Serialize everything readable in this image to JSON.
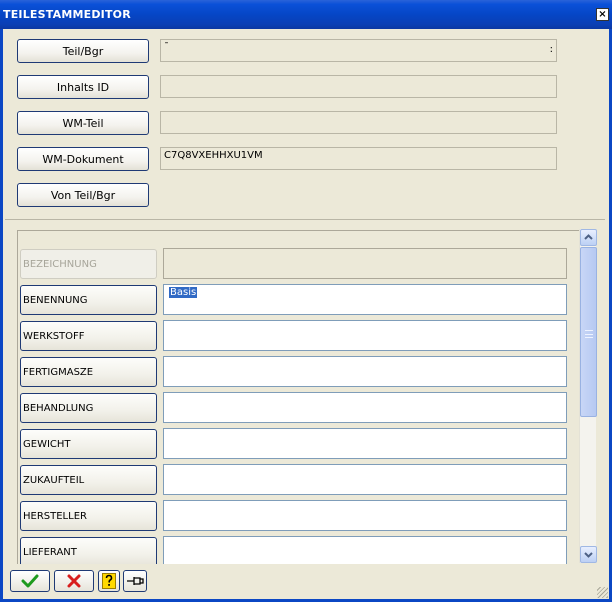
{
  "window": {
    "title": "TEILESTAMMEDITOR",
    "close_label": "×"
  },
  "top_section": {
    "buttons": [
      {
        "label": "Teil/Bgr",
        "value": "¯",
        "tick": ":"
      },
      {
        "label": "Inhalts ID",
        "value": ""
      },
      {
        "label": "WM-Teil",
        "value": ""
      },
      {
        "label": "WM-Dokument",
        "value": "C7Q8VXEHHXU1VM"
      }
    ],
    "von_button": "Von Teil/Bgr"
  },
  "attributes": {
    "rows": [
      {
        "label": "BEZEICHNUNG",
        "value": "",
        "disabled": true
      },
      {
        "label": "BENENNUNG",
        "value": "Basis",
        "selected": true
      },
      {
        "label": "WERKSTOFF",
        "value": ""
      },
      {
        "label": "FERTIGMASZE",
        "value": ""
      },
      {
        "label": "BEHANDLUNG",
        "value": ""
      },
      {
        "label": "GEWICHT",
        "value": ""
      },
      {
        "label": "ZUKAUFTEIL",
        "value": ""
      },
      {
        "label": "HERSTELLER",
        "value": ""
      },
      {
        "label": "LIEFERANT",
        "value": ""
      }
    ]
  },
  "scrollbar": {
    "up_icon": "scroll-up-arrow",
    "down_icon": "scroll-down-arrow"
  },
  "toolbar": {
    "buttons": [
      {
        "name": "ok-button",
        "icon": "green-check-icon",
        "color": "#1e9a1e"
      },
      {
        "name": "cancel-button",
        "icon": "red-x-icon",
        "color": "#d81d1d"
      },
      {
        "name": "help-button",
        "icon": "question-mark-icon",
        "color": "#d6b300"
      },
      {
        "name": "pin-button",
        "icon": "pushpin-icon",
        "color": "#000000"
      }
    ]
  }
}
